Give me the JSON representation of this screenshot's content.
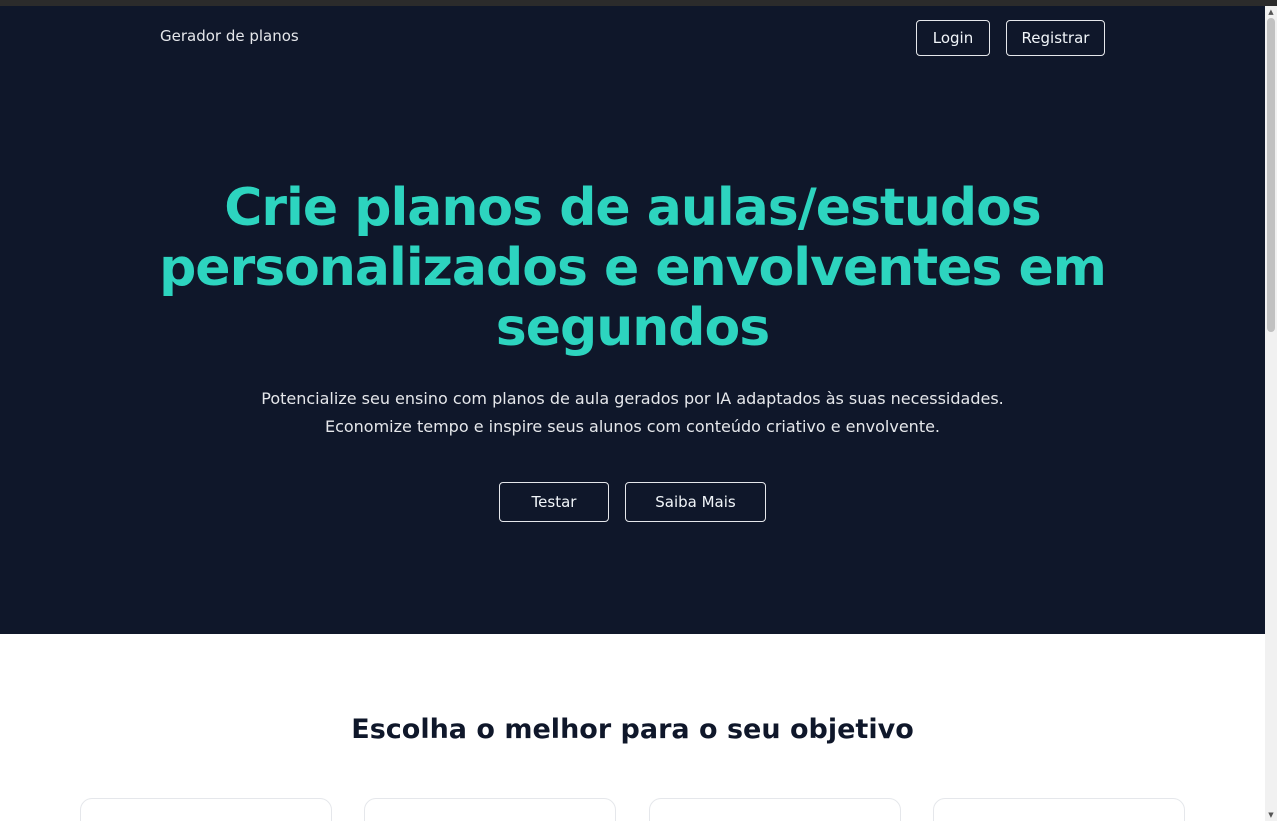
{
  "header": {
    "brand": "Gerador de planos",
    "login_label": "Login",
    "register_label": "Registrar"
  },
  "hero": {
    "title": "Crie planos de aulas/estudos personalizados e envolventes em segundos",
    "subtitle_line1": "Potencialize seu ensino com planos de aula gerados por IA adaptados às suas necessidades.",
    "subtitle_line2": "Economize tempo e inspire seus alunos com conteúdo criativo e envolvente.",
    "test_label": "Testar",
    "more_label": "Saiba Mais"
  },
  "plans": {
    "title": "Escolha o melhor para o seu objetivo"
  },
  "scrollbar": {
    "up_icon": "triangle-up-icon",
    "down_icon": "triangle-down-icon"
  },
  "colors": {
    "hero_background": "#0f172a",
    "accent": "#2dd4bf",
    "section_title": "#0f172a"
  }
}
